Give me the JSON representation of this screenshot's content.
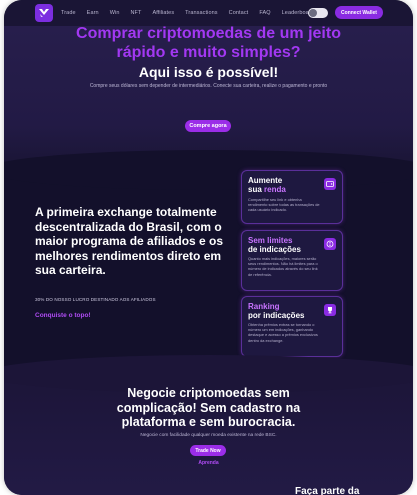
{
  "nav": {
    "links": [
      "Trade",
      "Earn",
      "Win",
      "NFT",
      "Affiliates",
      "Transactions",
      "Contact",
      "FAQ",
      "Leaderboard"
    ],
    "connect_label": "Connect Wallet"
  },
  "hero": {
    "title": "Comprar criptomoedas de um jeito rápido e muito simples?",
    "subtitle": "Aqui isso é possível!",
    "description": "Compre seus dólares sem depender de intermediários. Conecte sua carteira, realize o pagamento e pronto",
    "cta_label": "Compre agora"
  },
  "middle": {
    "title": "A primeira exchange totalmente descentralizada do Brasil, com o maior programa de afiliados e os melhores rendimentos direto em sua carteira.",
    "note": "30% DO NOSSO LUCRO DESTINADO AOS AFILIADOS",
    "link_label": "Conquiste o topo!"
  },
  "cards": [
    {
      "title_white": "Aumente",
      "title_line2_white": "sua ",
      "title_line2_hl": "renda",
      "body": "Compartilhe seu link e obtenha rendimento sobre todas as transações de cada usuário indicado.",
      "icon": "wallet-icon"
    },
    {
      "title_hl": "Sem limites",
      "title_line2_white": "de indicações",
      "body": "Quanto mais indicações, maiores serão seus rendimentos. Não há limites para o número de indicados através do seu link de referência.",
      "icon": "coin-icon"
    },
    {
      "title_hl": "Ranking",
      "title_line2_white": "por indicações",
      "body": "Obtenha prêmios extras se tornando o número um em indicações, ganhando destaque e acesso a prêmios exclusivos dentro da exchange.",
      "icon": "trophy-icon"
    }
  ],
  "bottom": {
    "title": "Negocie criptomoedas sem complicação! Sem cadastro na plataforma e sem burocracia.",
    "description": "Negocie com facilidade qualquer moeda existente na rede BSC.",
    "cta_label": "Trade Now",
    "link_label": "Aprenda",
    "footer_peek": "Faça parte da"
  },
  "colors": {
    "accent": "#9b2de8",
    "background": "#13102b",
    "hero_title": "#a238f2"
  }
}
